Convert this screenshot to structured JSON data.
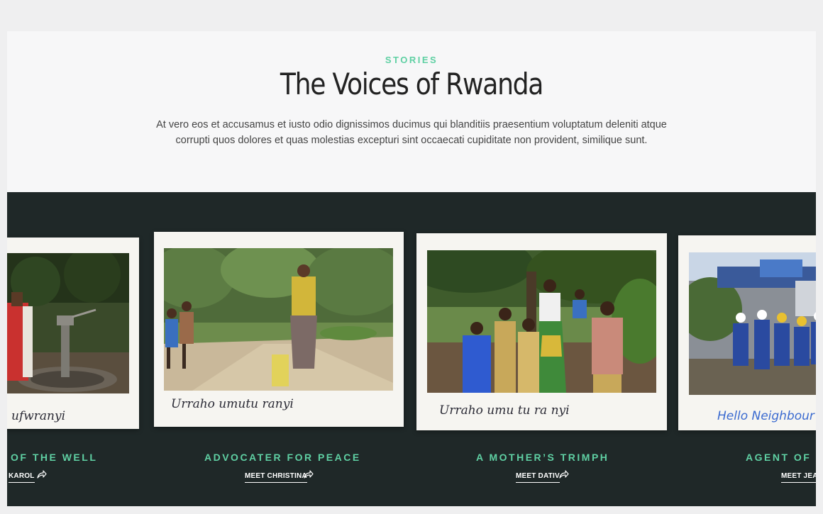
{
  "header": {
    "eyebrow": "STORIES",
    "title": "The Voices of Rwanda",
    "description": "At vero eos et accusamus et iusto odio dignissimos ducimus qui blanditiis praesentium voluptatum deleniti atque corrupti quos dolores et quas molestias excepturi sint occaecati cupiditate non provident, similique sunt."
  },
  "stories": [
    {
      "title": "OF THE WELL",
      "cta": "KAROL",
      "caption": "ufwranyi"
    },
    {
      "title": "ADVOCATER FOR PEACE",
      "cta": "MEET CHRISTINA",
      "caption": "Urraho umutu ranyi"
    },
    {
      "title": "A MOTHER’S TRIMPH",
      "cta": "MEET DATIV",
      "caption": "Urraho umu tu ra nyi"
    },
    {
      "title": "AGENT OF C",
      "cta": "MEET JEAN",
      "caption": "Hello Neighbour"
    }
  ],
  "icons": {
    "share": "share-arrow-icon"
  },
  "colors": {
    "accent": "#5fd0a3",
    "band": "#1f2828"
  }
}
